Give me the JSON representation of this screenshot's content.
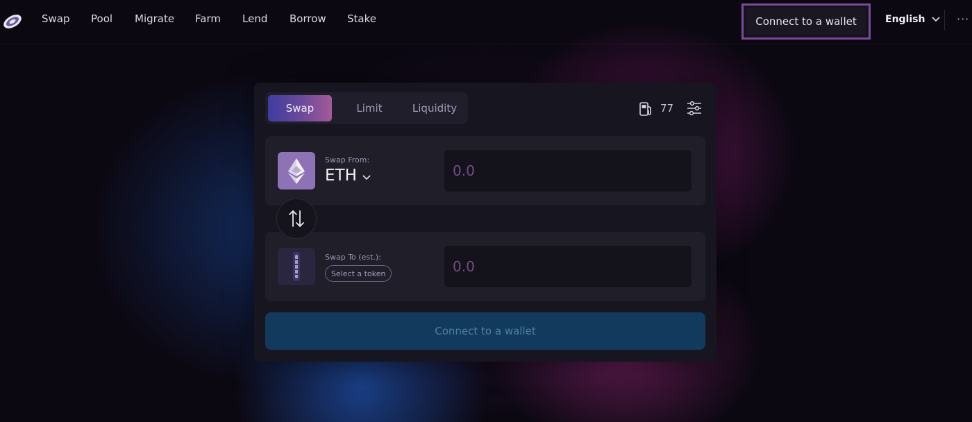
{
  "nav": {
    "links": [
      "Swap",
      "Pool",
      "Migrate",
      "Farm",
      "Lend",
      "Borrow",
      "Stake"
    ],
    "connect_wallet": "Connect to a wallet",
    "language": "English",
    "more": "···"
  },
  "swap_card": {
    "tabs": [
      {
        "label": "Swap",
        "active": true
      },
      {
        "label": "Limit",
        "active": false
      },
      {
        "label": "Liquidity",
        "active": false
      }
    ],
    "gas_price": "77",
    "from": {
      "label": "Swap From:",
      "token": "ETH",
      "token_icon": "ethereum-icon",
      "amount_placeholder": "0.0"
    },
    "to": {
      "label": "Swap To (est.):",
      "select_token": "Select a token",
      "token_icon": "placeholder-token-icon",
      "amount_placeholder": "0.0"
    },
    "connect_wallet": "Connect to a wallet"
  },
  "colors": {
    "accent_purple": "#7b4a9a",
    "tab_gradient_start": "#3d3d9e",
    "tab_gradient_end": "#a35a98",
    "connect_button_bg": "#123a5c",
    "amount_placeholder": "#6f4e86"
  }
}
